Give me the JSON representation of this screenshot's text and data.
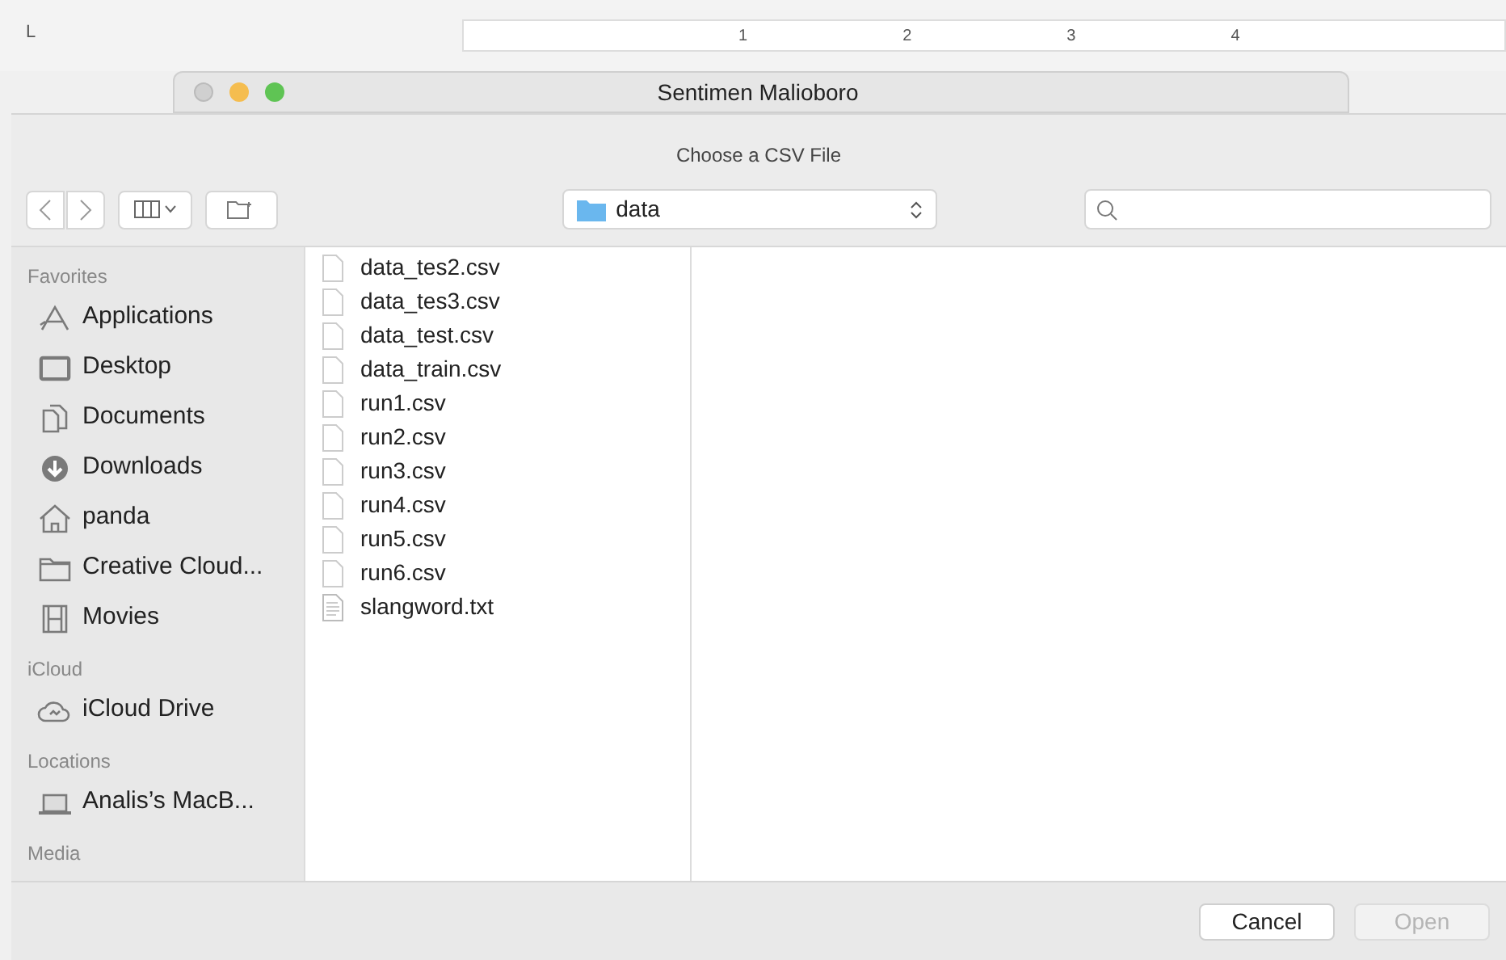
{
  "ruler": {
    "marker": "L",
    "numbers": [
      "1",
      "2",
      "3",
      "4"
    ]
  },
  "window": {
    "title": "Sentimen Malioboro"
  },
  "dialog": {
    "prompt": "Choose a CSV File",
    "location": "data"
  },
  "sidebar": {
    "sections": [
      {
        "heading": "Favorites",
        "items": [
          {
            "label": "Applications",
            "kind": "apps"
          },
          {
            "label": "Desktop",
            "kind": "desktop"
          },
          {
            "label": "Documents",
            "kind": "documents"
          },
          {
            "label": "Downloads",
            "kind": "downloads"
          },
          {
            "label": "panda",
            "kind": "home"
          },
          {
            "label": "Creative Cloud...",
            "kind": "folder"
          },
          {
            "label": "Movies",
            "kind": "movies"
          }
        ]
      },
      {
        "heading": "iCloud",
        "items": [
          {
            "label": "iCloud Drive",
            "kind": "cloud"
          }
        ]
      },
      {
        "heading": "Locations",
        "items": [
          {
            "label": "Analis’s MacB...",
            "kind": "laptop"
          }
        ]
      },
      {
        "heading": "Media"
      }
    ]
  },
  "files": [
    {
      "name": "data_tes2.csv",
      "kind": "blank"
    },
    {
      "name": "data_tes3.csv",
      "kind": "blank"
    },
    {
      "name": "data_test.csv",
      "kind": "blank"
    },
    {
      "name": "data_train.csv",
      "kind": "blank"
    },
    {
      "name": "run1.csv",
      "kind": "blank"
    },
    {
      "name": "run2.csv",
      "kind": "blank"
    },
    {
      "name": "run3.csv",
      "kind": "blank"
    },
    {
      "name": "run4.csv",
      "kind": "blank"
    },
    {
      "name": "run5.csv",
      "kind": "blank"
    },
    {
      "name": "run6.csv",
      "kind": "blank"
    },
    {
      "name": "slangword.txt",
      "kind": "text"
    }
  ],
  "buttons": [
    {
      "label": "Cancel",
      "disabled": false
    },
    {
      "label": "Open",
      "disabled": true
    }
  ]
}
